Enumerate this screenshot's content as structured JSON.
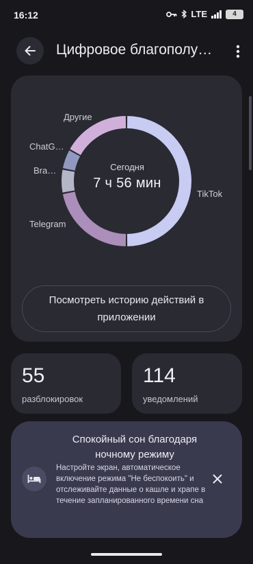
{
  "status_bar": {
    "time": "16:12",
    "network": "LTE",
    "battery": "4"
  },
  "header": {
    "title": "Цифровое благополу…"
  },
  "usage": {
    "center_label": "Сегодня",
    "total": "7 ч 56 мин",
    "history_button": "Посмотреть историю действий в приложении"
  },
  "chart_data": {
    "type": "pie",
    "title": "",
    "center_text": [
      "Сегодня",
      "7 ч 56 мин"
    ],
    "series": [
      {
        "name": "TikTok",
        "value": 50.0,
        "color": "#c8cbf2"
      },
      {
        "name": "Telegram",
        "value": 22.0,
        "color": "#ac8eba"
      },
      {
        "name": "Bra…",
        "value": 6.0,
        "color": "#b4b6c6"
      },
      {
        "name": "ChatG…",
        "value": 5.0,
        "color": "#9299c0"
      },
      {
        "name": "Другие",
        "value": 17.0,
        "color": "#d0b0da"
      }
    ]
  },
  "stats": {
    "unlocks": {
      "value": "55",
      "label": "разблокировок"
    },
    "notifications": {
      "value": "114",
      "label": "уведомлений"
    }
  },
  "sleep_card": {
    "title": "Спокойный сон благодаря ночному режиму",
    "description": "Настройте экран, автоматическое включение режима \"Не беспокоить\" и отслеживайте данные о кашле и храпе в течение запланированного времени сна"
  },
  "icons": {
    "back": "arrow-left-icon",
    "more": "more-vert-icon",
    "bed": "bed-icon",
    "close": "close-icon"
  }
}
